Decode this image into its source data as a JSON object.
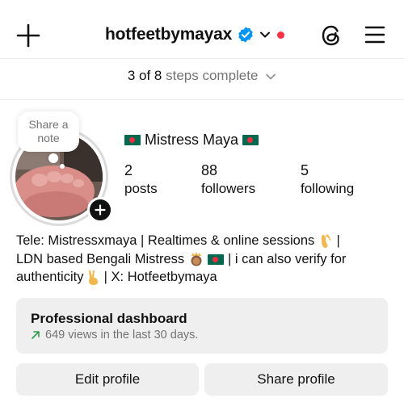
{
  "header": {
    "username": "hotfeetbymayax",
    "plus_icon": "plus-icon",
    "verified_icon": "verified-badge-icon",
    "threads_icon": "threads-icon",
    "menu_icon": "hamburger-menu-icon",
    "notification_dot_color": "#ff3040",
    "verified_color": "#0095f6"
  },
  "steps": {
    "prefix": "3 of 8",
    "suffix": "steps complete"
  },
  "profile": {
    "note_line1": "Share a",
    "note_line2": "note",
    "display_name": "Mistress Maya",
    "stats": [
      {
        "value": "2",
        "label": "posts"
      },
      {
        "value": "88",
        "label": "followers"
      },
      {
        "value": "5",
        "label": "following"
      }
    ],
    "bio": {
      "line1_a": "Tele: Mistressxmaya | Realtimes & online sessions",
      "line1_b": " |",
      "line2_a": "LDN based Bengali Mistress",
      "line2_b": "| i can also verify for",
      "line3_a": "authenticity",
      "line3_b": " | X: Hotfeetbymaya"
    }
  },
  "dashboard": {
    "title": "Professional dashboard",
    "subtitle": "649 views in the last 30 days.",
    "trend_color": "#2a9d4a"
  },
  "actions": {
    "edit_label": "Edit profile",
    "share_label": "Share profile"
  }
}
